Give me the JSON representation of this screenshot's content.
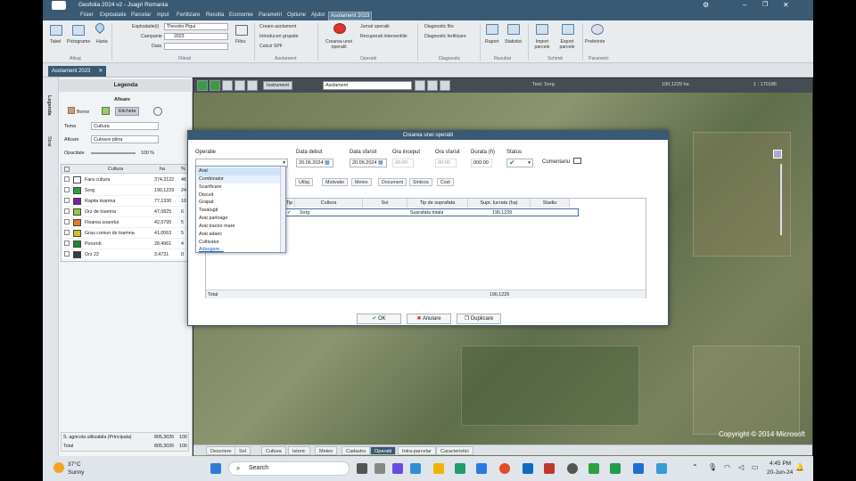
{
  "window": {
    "title": "Geofolia 2024 v2 - Jsagri Romania"
  },
  "menu": [
    "Fisier",
    "Exploatatie",
    "Parcelar",
    "Input",
    "Fertilizare",
    "Recolta",
    "Economie",
    "Parametri",
    "Optiune",
    "Ajutor",
    "Asolament 2023"
  ],
  "ribbon": {
    "buttons": {
      "tabel": "Tabel",
      "pictograme": "Pictograme",
      "harta": "Harta",
      "filtru": "Filtru",
      "creare_operatii": "Crearea unei operatii",
      "raport": "Raport",
      "statistici": "Statistici",
      "import": "Import parcele",
      "export": "Export parcele",
      "preferinte": "Preferinte"
    },
    "exploatatie_label": "Exploatatie(i)",
    "exploatatie_value": "Theodor Pigui",
    "campanie_label": "Campanie",
    "campanie_value": "2023",
    "data_label": "Data",
    "asolament_items": [
      "Creare asolament",
      "Introduceri grupate",
      "Calcul SPF"
    ],
    "jurnal_items": [
      "Jurnal operatii",
      "Recuperati interventiile"
    ],
    "diagnostic_items": [
      "Diagnostic fito",
      "Diagnostic fertilizare"
    ],
    "groups": [
      "Afisaj",
      "Filtrati",
      "Asolament",
      "Operatii",
      "Diagnostic",
      "Rezultat",
      "Schimb",
      "Parametri"
    ]
  },
  "doc_tab": "Asolament 2023",
  "left": {
    "legend_title": "Legenda",
    "afisare": "Afisare",
    "borne": "Borne",
    "eticheta": "Eticheta",
    "tema_label": "Tema",
    "tema_value": "Cultura",
    "afisare_label": "Afisare",
    "afisare_value": "Culoare plina",
    "opacitate_label": "Opacitate",
    "opacitate_value": "100 %",
    "col_cultura": "Cultura",
    "col_ha": "ha",
    "col_pct": "%",
    "rows": [
      {
        "name": "Fara cultura",
        "ha": "374,3122",
        "pct": "46",
        "color": "#ffffff"
      },
      {
        "name": "Sorg",
        "ha": "190,1229",
        "pct": "24",
        "color": "#2ea043"
      },
      {
        "name": "Rapita toamna",
        "ha": "77,1330",
        "pct": "10",
        "color": "#7a1fa2"
      },
      {
        "name": "Orz de toamna",
        "ha": "47,0825",
        "pct": "6",
        "color": "#8fce3a"
      },
      {
        "name": "Floarea soarelui",
        "ha": "42,0795",
        "pct": "5",
        "color": "#e07b20"
      },
      {
        "name": "Grau comun de toamna",
        "ha": "41,0063",
        "pct": "5",
        "color": "#c9c12a"
      },
      {
        "name": "Porumb",
        "ha": "28,4961",
        "pct": "4",
        "color": "#1c8a2c"
      },
      {
        "name": "Orz 22",
        "ha": "3,4731",
        "pct": "0",
        "color": "#3a3a3a"
      }
    ],
    "footer_sau_label": "S. agricola utilizabila (Principala)",
    "footer_sau_ha": "805,3026",
    "footer_sau_pct": "100",
    "footer_total_label": "Total",
    "footer_total_ha": "805,3026",
    "footer_total_pct": "100",
    "vtabs": [
      "Legenda",
      "Strat"
    ]
  },
  "map": {
    "search_value": "Asolament",
    "mode_label": "Instrument",
    "text_layer": "Text: Sorg",
    "area_text": "190,1229 ha",
    "scale_text": "1 : 170186",
    "copyright": "Copyright © 2014 Microsoft"
  },
  "modal": {
    "title": "Crearea unei operatii",
    "operatie_label": "Operatie",
    "data_debut_label": "Data debut",
    "data_debut_value": "20.06.2024",
    "data_sfarsit_label": "Data sfarsit",
    "data_sfarsit_value": "20.06.2024",
    "ora_inceput_label": "Ora inceput",
    "ora_inceput_ph": "00:00",
    "ora_sfarsit_label": "Ora sfarsit",
    "ora_sfarsit_ph": "00:00",
    "durata_label": "Durata (h)",
    "durata_value": "000:00",
    "status_label": "Status",
    "comentariu_label": "Comentariu",
    "subtabs": [
      "Utilaj",
      "Motivatie",
      "Meteo",
      "Document",
      "Sinteza",
      "Cost"
    ],
    "grid_headers": [
      "Tip",
      "Cultura",
      "Soi",
      "Tip de suprafata",
      "Supr. lucrata (ha)",
      "Stadiu"
    ],
    "grid_row": {
      "cultura": "Sorg",
      "soi": "",
      "tip": "Suprafata totala",
      "supr": "190,1229",
      "stadiu": ""
    },
    "total_label": "Total",
    "total_value": "190,1229",
    "ok": "OK",
    "anulare": "Anulare",
    "duplicare": "Duplicare",
    "dropdown": [
      "Arat",
      "Combinator",
      "Scarificare",
      "Discuit",
      "Grapat",
      "Tavalugit",
      "Arat parloage",
      "Arat tractor mare",
      "Arat adanc",
      "Cultivator"
    ],
    "adaugare": "Adaugare..."
  },
  "bottom_tabs": [
    "Descriere",
    "Sol",
    "Cultura",
    "Istoric",
    "Meteo",
    "Cadastru",
    "Operatii",
    "Intra-parcelar",
    "Caracteristici"
  ],
  "taskbar": {
    "weather_temp": "37°C",
    "weather_text": "Sunny",
    "search": "Search",
    "time": "4:45 PM",
    "date": "20-Jun-24"
  }
}
